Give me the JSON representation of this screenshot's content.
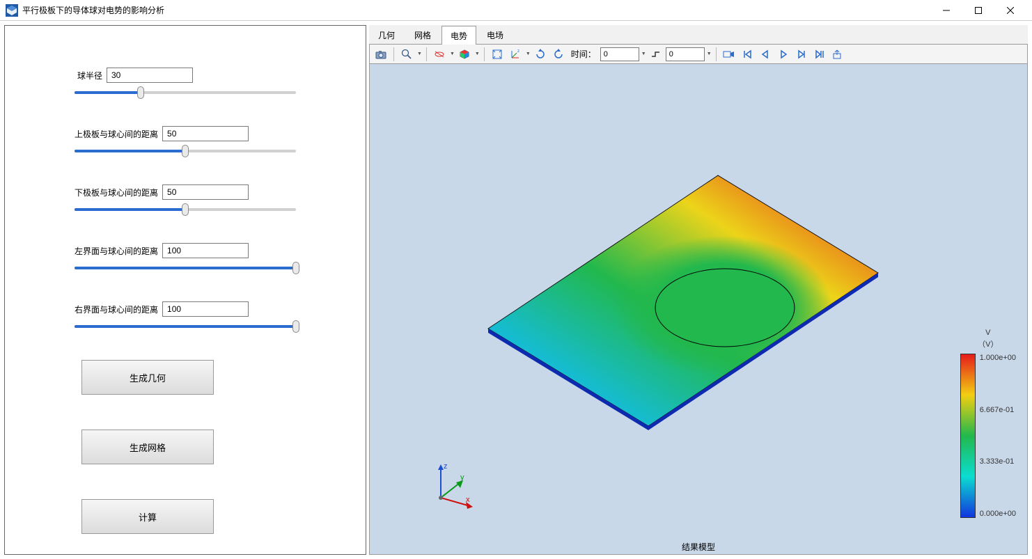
{
  "window": {
    "title": "平行极板下的导体球对电势的影响分析"
  },
  "sidebar": {
    "fields": [
      {
        "label": "球半径",
        "value": "30",
        "slider_pct": 30
      },
      {
        "label": "上极板与球心间的距离",
        "value": "50",
        "slider_pct": 50
      },
      {
        "label": "下极板与球心间的距离",
        "value": "50",
        "slider_pct": 50
      },
      {
        "label": "左界面与球心间的距离",
        "value": "100",
        "slider_pct": 100
      },
      {
        "label": "右界面与球心间的距离",
        "value": "100",
        "slider_pct": 100
      }
    ],
    "buttons": {
      "gen_geom": "生成几何",
      "gen_mesh": "生成网格",
      "compute": "计算"
    }
  },
  "panel": {
    "tabs": [
      {
        "label": "几何",
        "active": false
      },
      {
        "label": "网格",
        "active": false
      },
      {
        "label": "电势",
        "active": true
      },
      {
        "label": "电场",
        "active": false
      }
    ],
    "time_label": "时间：",
    "time_value": "0",
    "split_value": "0",
    "footer_label": "结果模型",
    "legend": {
      "title1": "V",
      "title2": "（V）",
      "ticks": [
        "1.000e+00",
        "6.667e-01",
        "3.333e-01",
        "0.000e+00"
      ]
    },
    "axes": {
      "x": "x",
      "y": "y",
      "z": "z"
    }
  }
}
